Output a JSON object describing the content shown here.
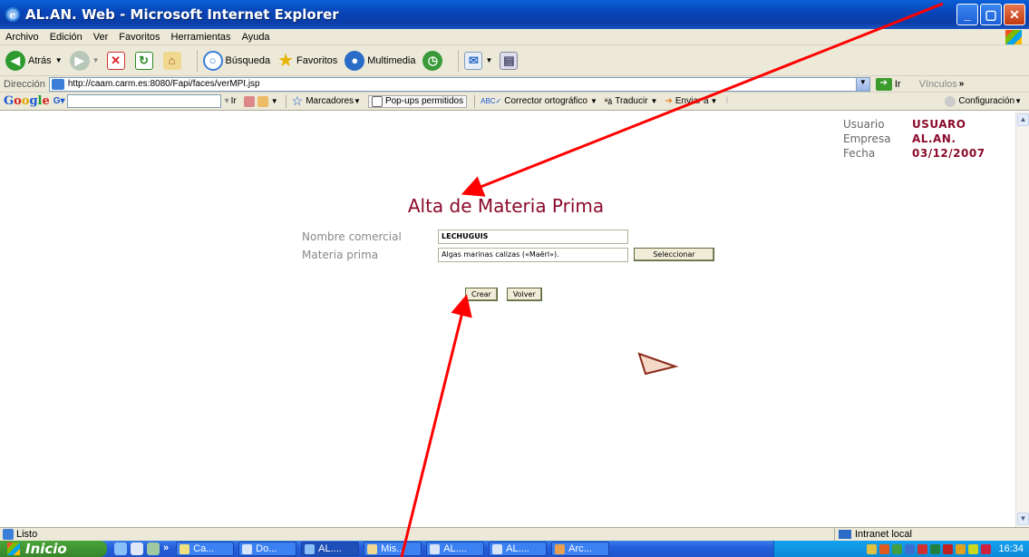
{
  "window": {
    "title": "AL.AN. Web - Microsoft Internet Explorer",
    "buttons": [
      "_",
      "▢",
      "✕"
    ]
  },
  "menu": {
    "items": [
      "Archivo",
      "Edición",
      "Ver",
      "Favoritos",
      "Herramientas",
      "Ayuda"
    ]
  },
  "toolbar": {
    "back": "Atrás",
    "search": "Búsqueda",
    "favorites": "Favoritos",
    "multimedia": "Multimedia"
  },
  "address": {
    "label": "Dirección",
    "url": "http://caam.carm.es:8080/Fapi/faces/verMPI.jsp",
    "go": "Ir",
    "links": "Vínculos"
  },
  "googlebar": {
    "search_value": "",
    "go": "Ir",
    "bookmarks": "Marcadores",
    "popups": "Pop-ups permitidos",
    "spell": "Corrector ortográfico",
    "translate": "Traducir",
    "send": "Enviar a",
    "settings": "Configuración"
  },
  "userinfo": {
    "user_label": "Usuario",
    "user_value": "USUARO",
    "company_label": "Empresa",
    "company_value": "AL.AN.",
    "date_label": "Fecha",
    "date_value": "03/12/2007"
  },
  "page": {
    "title": "Alta de Materia Prima"
  },
  "form": {
    "nombre_label": "Nombre comercial",
    "nombre_value": "LECHUGUIS",
    "materia_label": "Materia prima",
    "materia_value": "Algas marinas calizas («Maërl»).",
    "select_button": "Seleccionar"
  },
  "actions": {
    "create": "Crear",
    "back": "Volver"
  },
  "status": {
    "text": "Listo",
    "zone": "Intranet local"
  },
  "taskbar": {
    "start": "Inicio",
    "tasks": [
      "Ca...",
      "Do...",
      "AL....",
      "Mis...",
      "AL....",
      "AL....",
      "Arc..."
    ],
    "clock": "16:34"
  },
  "colors": {
    "accent": "#8b0a2a",
    "annotation": "#ff0000"
  }
}
